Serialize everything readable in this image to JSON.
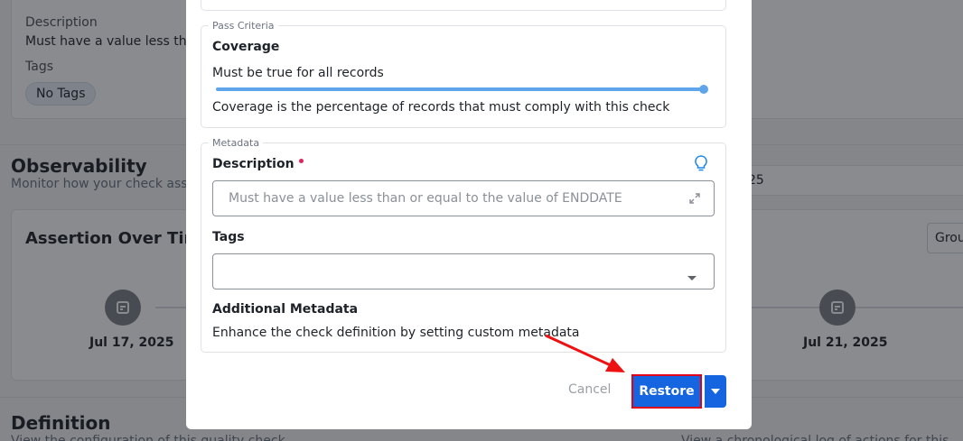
{
  "background": {
    "description_label": "Description",
    "description_value": "Must have a value less thar",
    "tags_label": "Tags",
    "tag_chip": "No Tags",
    "observability_title": "Observability",
    "observability_sub": "Monitor how your check asser",
    "right_value": "25",
    "assertion_title": "Assertion Over Time",
    "group_button": "Grou",
    "timeline_dates": [
      "Jul 17, 2025",
      "Jul 21, 2025"
    ],
    "definition_title": "Definition",
    "definition_sub": "View the configuration of this quality check",
    "activity_sub": "View a chronological log of actions for this check"
  },
  "modal": {
    "pass_criteria": {
      "legend": "Pass Criteria",
      "coverage_label": "Coverage",
      "coverage_rule": "Must be true for all records",
      "coverage_value": 1.0,
      "coverage_help": "Coverage is the percentage of records that must comply with this check"
    },
    "metadata": {
      "legend": "Metadata",
      "description_label": "Description",
      "description_value": "Must have a value less than or equal to the value of ENDDATE",
      "tags_label": "Tags",
      "tags_value": "",
      "additional_label": "Additional Metadata",
      "additional_help": "Enhance the check definition by setting custom metadata"
    },
    "footer": {
      "cancel_label": "Cancel",
      "restore_label": "Restore"
    }
  },
  "colors": {
    "primary": "#1565e0",
    "slider": "#60a5ea",
    "required": "#e0245e",
    "highlight": "#e0001b",
    "overlay": "rgba(20,24,30,0.5)"
  }
}
